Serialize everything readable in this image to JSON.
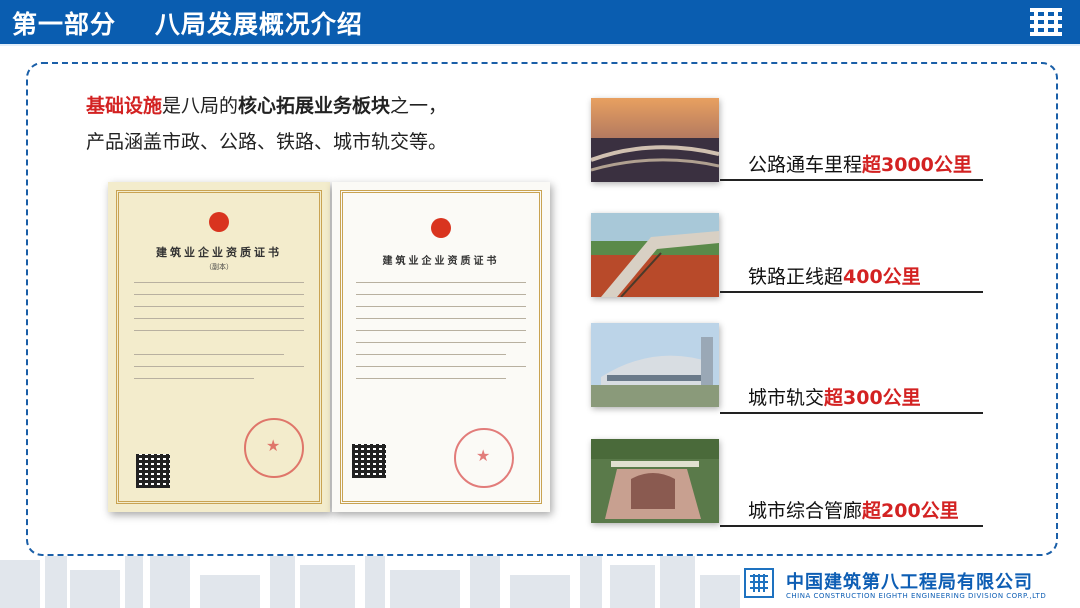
{
  "header": {
    "title": "第一部分    八局发展概况介绍",
    "logo_icon": "company-emblem-icon",
    "background": "#0a5db0"
  },
  "intro": {
    "line1_highlight": "基础设施",
    "line1_part2": "是八局的",
    "line1_bold": "核心拓展业务板块",
    "line1_part3": "之一，",
    "line2": "产品涵盖市政、公路、铁路、城市轨交等。"
  },
  "certificates": [
    {
      "title": "建筑业企业资质证书",
      "subtitle": "（副本）"
    },
    {
      "title": "建筑业企业资质证书"
    }
  ],
  "items": [
    {
      "prefix": "公路通车里程",
      "highlight": "超3000公里"
    },
    {
      "prefix": "铁路正线超",
      "highlight": "400公里"
    },
    {
      "prefix": "城市轨交",
      "highlight": "超300公里"
    },
    {
      "prefix": "城市综合管廊",
      "highlight": "超200公里"
    }
  ],
  "footer": {
    "name": "中国建筑第八工程局有限公司",
    "name_en": "CHINA CONSTRUCTION EIGHTH ENGINEERING DIVISION CORP.,LTD"
  },
  "colors": {
    "accent_red": "#d32222",
    "brand_blue": "#0e5eb4",
    "frame_blue": "#1a5fa8"
  }
}
